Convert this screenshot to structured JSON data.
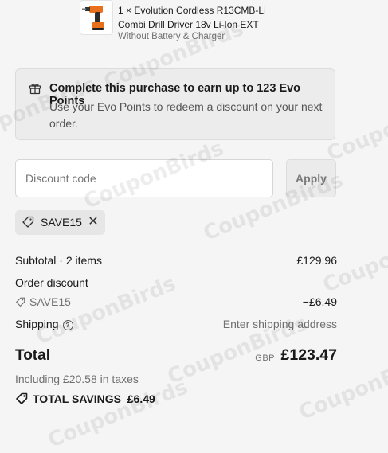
{
  "product": {
    "name": "1 × Evolution Cordless R13CMB-Li Combi Drill Driver 18v Li-Ion EXT",
    "variant": "Without Battery & Charger"
  },
  "points": {
    "title": "Complete this purchase to earn up to 123 Evo Points",
    "body": "Use your Evo Points to redeem a discount on your next order."
  },
  "discount": {
    "placeholder": "Discount code",
    "apply_label": "Apply"
  },
  "applied_code": {
    "code": "SAVE15"
  },
  "summary": {
    "subtotal_label": "Subtotal · 2 items",
    "subtotal_value": "£129.96",
    "order_discount_label": "Order discount",
    "discount_code": "SAVE15",
    "discount_value": "−£6.49",
    "shipping_label": "Shipping",
    "shipping_value": "Enter shipping address",
    "total_label": "Total",
    "currency": "GBP",
    "total_value": "£123.47",
    "taxes": "Including £20.58 in taxes",
    "savings_label": "TOTAL SAVINGS",
    "savings_value": "£6.49"
  },
  "watermark": "CouponBirds"
}
